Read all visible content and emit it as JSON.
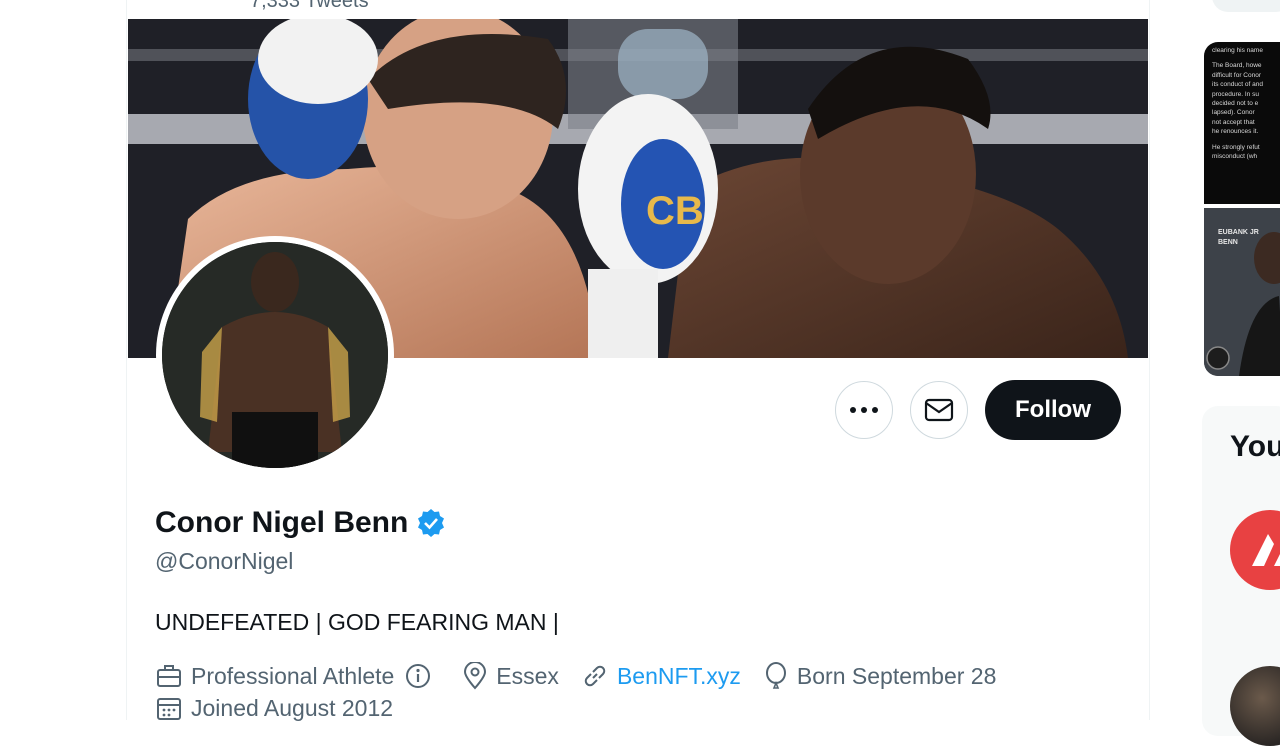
{
  "header": {
    "tweets_count": "7,333 Tweets"
  },
  "profile": {
    "name": "Conor Nigel Benn",
    "handle": "@ConorNigel",
    "bio": "UNDEFEATED | GOD FEARING MAN |",
    "category": "Professional Athlete",
    "location": "Essex",
    "website": "BenNFT.xyz",
    "birthday": "Born September 28",
    "joined": "Joined August 2012",
    "verified": true
  },
  "actions": {
    "more_icon": "more-icon",
    "message_icon": "mail-icon",
    "follow_label": "Follow"
  },
  "sidebar_right": {
    "section_heading": "You",
    "news_text_lines": [
      "clearing his name",
      "The Board, howe",
      "difficult for Conor",
      "its conduct of and",
      "procedure. In su",
      "decided not to e",
      "lapsed). Conor",
      "not accept that",
      "he renounces it.",
      "He strongly refut",
      "misconduct (wh"
    ],
    "poster_text": [
      "EUBANK JR",
      "BENN"
    ]
  },
  "colors": {
    "accent": "#1d9bf0",
    "follow_bg": "#0f1419",
    "muted": "#536471",
    "avax_red": "#e84142"
  }
}
